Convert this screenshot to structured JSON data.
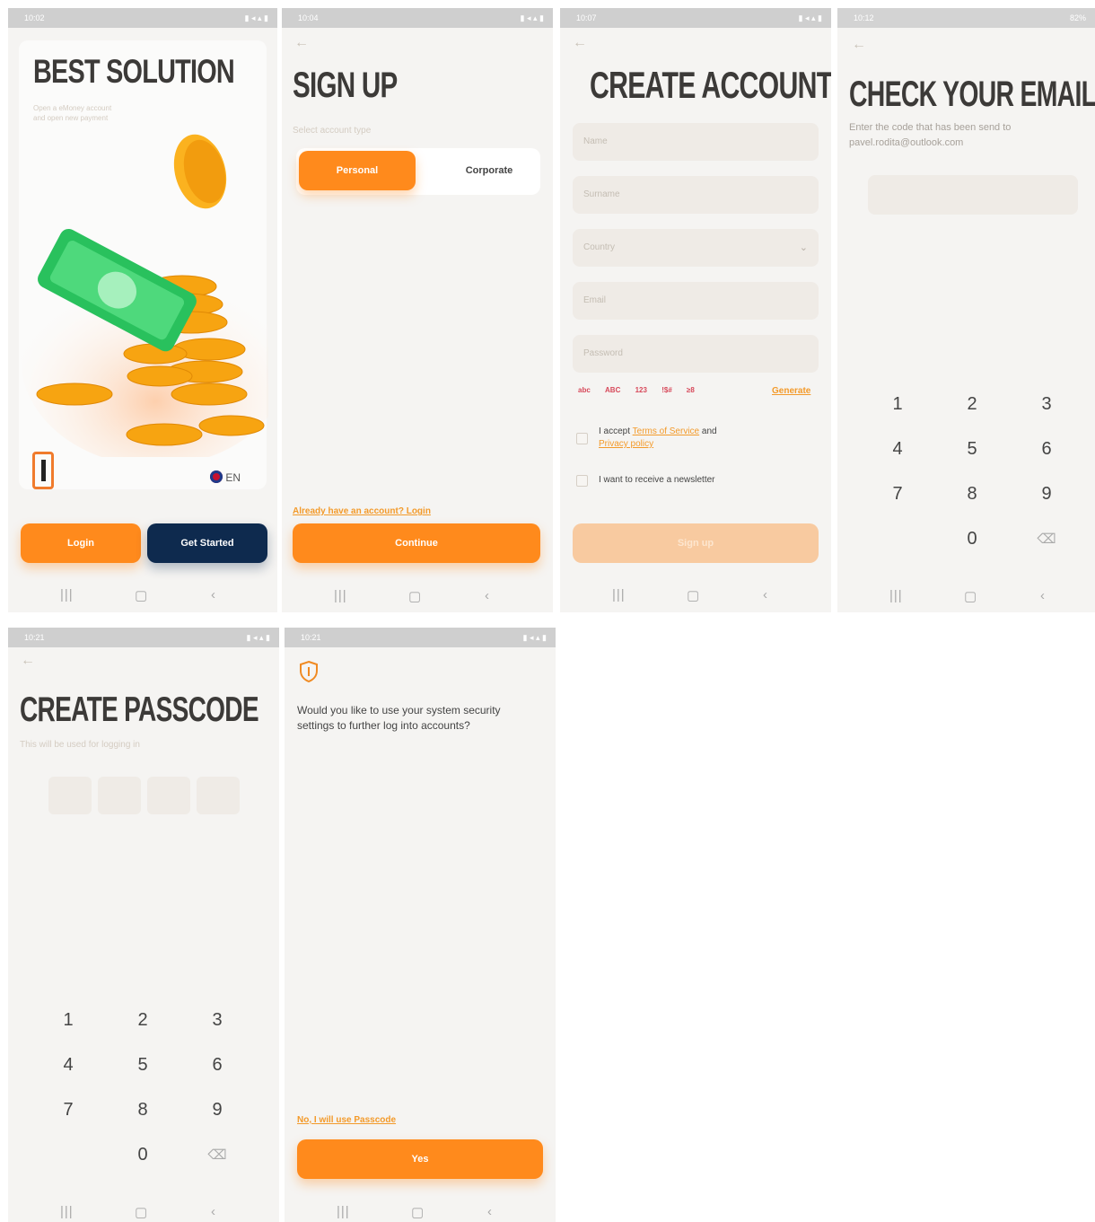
{
  "status": {
    "s1_time": "10:02",
    "s2_time": "10:04",
    "s3_time": "10:07",
    "s4_time": "10:12",
    "s5_time": "10:21",
    "s6_time": "10:21",
    "s4_battery": "82%"
  },
  "screen1": {
    "title": "BEST SOLUTION",
    "subtitle_line1": "Open a eMoney account",
    "subtitle_line2": "and open new payment",
    "language": "EN",
    "login_label": "Login",
    "get_started_label": "Get Started"
  },
  "screen2": {
    "title": "SIGN UP",
    "account_type_label": "Select account type",
    "personal_label": "Personal",
    "corporate_label": "Corporate",
    "login_link": "Already have an account? Login",
    "continue_label": "Continue"
  },
  "screen3": {
    "title": "CREATE ACCOUNT",
    "name_placeholder": "Name",
    "surname_placeholder": "Surname",
    "country_placeholder": "Country",
    "email_placeholder": "Email",
    "password_placeholder": "Password",
    "rule_lower": "abc",
    "rule_upper": "ABC",
    "rule_digits": "123",
    "rule_symbols": "!$#",
    "rule_length": "≥8",
    "generate_label": "Generate",
    "accept_prefix": "I accept",
    "terms_link": "Terms of Service",
    "and_text": "and",
    "privacy_link": "Privacy policy",
    "newsletter_label": "I want to receive a newsletter",
    "signup_label": "Sign up"
  },
  "screen4": {
    "title": "CHECK YOUR EMAIL",
    "instruction": "Enter the code that has been send to",
    "email": "pavel.rodita@outlook.com"
  },
  "screen5": {
    "title": "CREATE PASSCODE",
    "subtitle": "This will be used for logging in"
  },
  "screen6": {
    "question": "Would you like to use your system security settings to further log into accounts?",
    "passcode_link": "No, I will use Passcode",
    "yes_label": "Yes"
  },
  "keypad": [
    "1",
    "2",
    "3",
    "4",
    "5",
    "6",
    "7",
    "8",
    "9",
    "0"
  ],
  "colors": {
    "accent": "#ff8a1c",
    "dark": "#0e2a4e",
    "background": "#f5f4f2"
  }
}
